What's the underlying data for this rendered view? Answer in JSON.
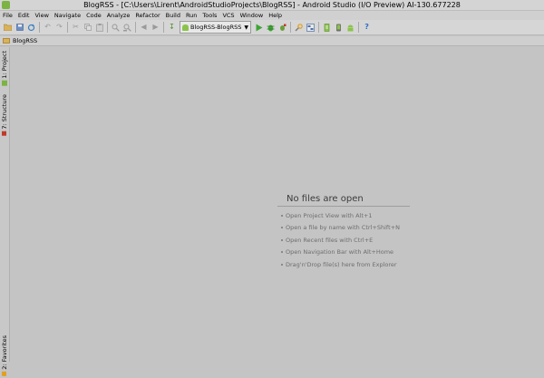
{
  "window": {
    "title": "BlogRSS - [C:\\Users\\Lirent\\AndroidStudioProjects\\BlogRSS] - Android Studio (I/O Preview) AI-130.677228"
  },
  "menu": [
    "File",
    "Edit",
    "View",
    "Navigate",
    "Code",
    "Analyze",
    "Refactor",
    "Build",
    "Run",
    "Tools",
    "VCS",
    "Window",
    "Help"
  ],
  "toolbar": {
    "run_config": "BlogRSS-BlogRSS",
    "icons": [
      "open-icon",
      "save-icon",
      "sync-icon",
      "undo-icon",
      "redo-icon",
      "cut-icon",
      "copy-icon",
      "paste-icon",
      "find-icon",
      "replace-icon",
      "back-icon",
      "forward-icon",
      "run-icon",
      "debug-icon",
      "attach-icon",
      "settings-icon",
      "project-structure-icon",
      "sdk-manager-icon",
      "avd-manager-icon",
      "android-icon",
      "help-icon"
    ]
  },
  "navbar": {
    "crumb": "BlogRSS"
  },
  "side_tabs": {
    "project": "1: Project",
    "structure": "7: Structure",
    "favorites": "2: Favorites"
  },
  "editor": {
    "empty_title": "No files are open",
    "hints": [
      "Open Project View with Alt+1",
      "Open a file by name with Ctrl+Shift+N",
      "Open Recent files with Ctrl+E",
      "Open Navigation Bar with Alt+Home",
      "Drag'n'Drop file(s) here from Explorer"
    ]
  },
  "colors": {
    "background": "#c4c4c4",
    "run_green": "#3fa535",
    "android_green": "#8bc34a"
  }
}
